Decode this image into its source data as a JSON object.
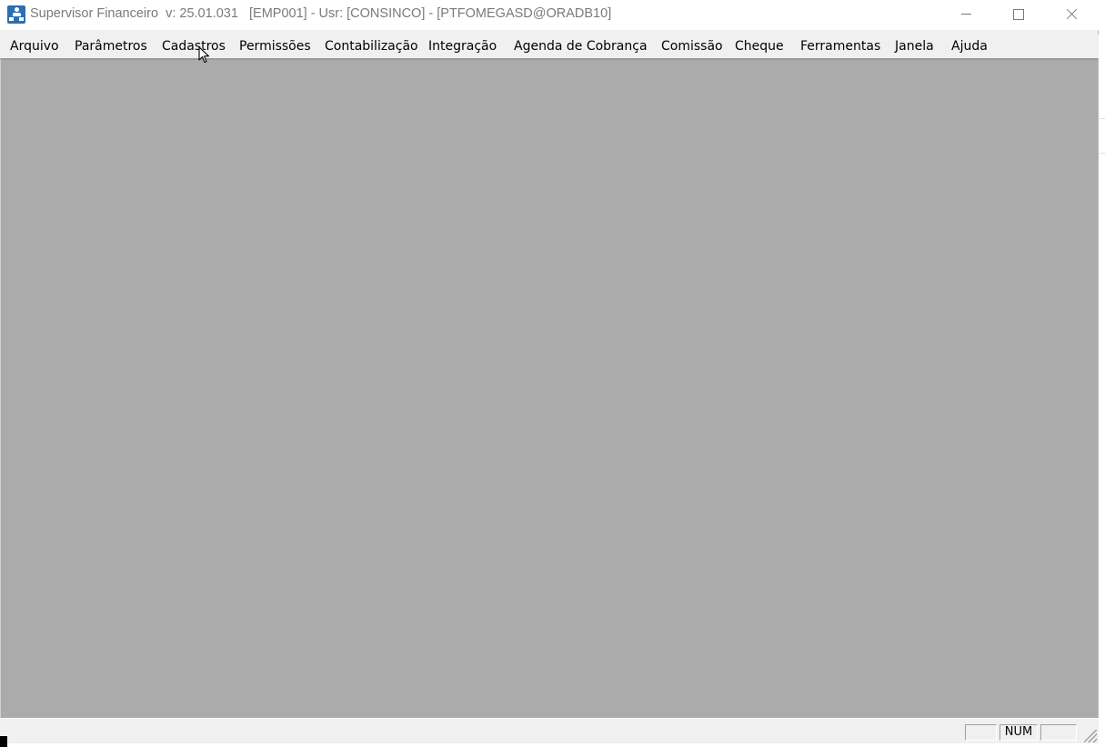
{
  "window": {
    "title": "Supervisor Financeiro  v: 25.01.031   [EMP001] - Usr: [CONSINCO] - [PTFOMEGASD@ORADB10]",
    "icon": "app-user-hierarchy-icon"
  },
  "window_controls": {
    "minimize": "minimize-icon",
    "maximize": "maximize-icon",
    "close": "close-icon"
  },
  "menu": {
    "items": [
      {
        "label": "Arquivo"
      },
      {
        "label": "Parâmetros"
      },
      {
        "label": "Cadastros"
      },
      {
        "label": "Permissões"
      },
      {
        "label": "Contabilização"
      },
      {
        "label": "Integração"
      },
      {
        "label": "Agenda de Cobrança"
      },
      {
        "label": "Comissão"
      },
      {
        "label": "Cheque"
      },
      {
        "label": "Ferramentas"
      },
      {
        "label": "Janela"
      },
      {
        "label": "Ajuda"
      }
    ]
  },
  "statusbar": {
    "panel1": "",
    "panel2": "NUM",
    "panel3": ""
  },
  "colors": {
    "mdi_background": "#ababab",
    "chrome": "#f0f0f0",
    "title_text": "#7a7a7a"
  }
}
